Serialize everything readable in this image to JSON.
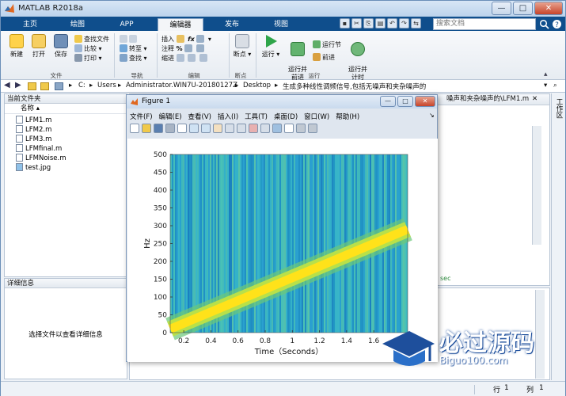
{
  "app": {
    "title": "MATLAB R2018a"
  },
  "tabs": [
    "主页",
    "绘图",
    "APP",
    "编辑器",
    "发布",
    "视图"
  ],
  "search": {
    "placeholder": "搜索文档"
  },
  "ribbon": {
    "new_label": "新建",
    "open_label": "打开",
    "save_label": "保存",
    "find_files_label": "查找文件",
    "compare_label": "比较",
    "print_label": "打印",
    "goto_label": "转至",
    "find_label": "查找",
    "insert_label": "插入",
    "comment_label": "注释",
    "indent_label": "缩进",
    "breakpoint_label": "断点",
    "run_label": "运行",
    "run_advance_label": "运行并\n前进",
    "run_section_label": "运行节",
    "advance_label": "前进",
    "run_time_label": "运行并\n计时",
    "groups": [
      "文件",
      "导航",
      "编辑",
      "断点",
      "运行"
    ]
  },
  "address": {
    "crumbs": [
      "C:",
      "Users",
      "Administrator.WIN7U-20180127Z",
      "Desktop",
      "生成多种线性调频信号,包括无噪声和夹杂噪声的"
    ]
  },
  "current_folder": {
    "header": "当前文件夹",
    "column": "名称",
    "files": [
      "LFM1.m",
      "LFM2.m",
      "LFM3.m",
      "LFMfinal.m",
      "LFMNoise.m",
      "test.jpg"
    ]
  },
  "details": {
    "header": "详细信息",
    "empty_text": "选择文件以查看详细信息"
  },
  "editor": {
    "tab_path": "噪声和夹杂噪声的\\LFM1.m",
    "side_label": "工作区",
    "snippet": "sec"
  },
  "figure": {
    "title": "Figure 1",
    "menu": [
      "文件(F)",
      "编辑(E)",
      "查看(V)",
      "插入(I)",
      "工具(T)",
      "桌面(D)",
      "窗口(W)",
      "帮助(H)"
    ]
  },
  "status": {
    "row_label": "行",
    "row_value": "1",
    "col_label": "列",
    "col_value": "1"
  },
  "watermark": {
    "title": "必过源码",
    "url": "Biguo100.com"
  },
  "chart_data": {
    "type": "heatmap",
    "xlabel": "Time（Seconds）",
    "ylabel": "Hz",
    "x_ticks": [
      0.2,
      0.4,
      0.6,
      0.8,
      1,
      1.2,
      1.4,
      1.6
    ],
    "y_ticks": [
      0,
      50,
      100,
      150,
      200,
      250,
      300,
      350,
      400,
      450,
      500
    ],
    "xlim": [
      0.1,
      1.85
    ],
    "ylim": [
      0,
      500
    ],
    "ridge": {
      "start": {
        "x": 0.1,
        "y": 10
      },
      "end": {
        "x": 1.85,
        "y": 290
      }
    },
    "colors": {
      "background": "#2ba8c9",
      "ridge_edge": "#b8e04a",
      "ridge_core": "#ffe21a"
    }
  }
}
